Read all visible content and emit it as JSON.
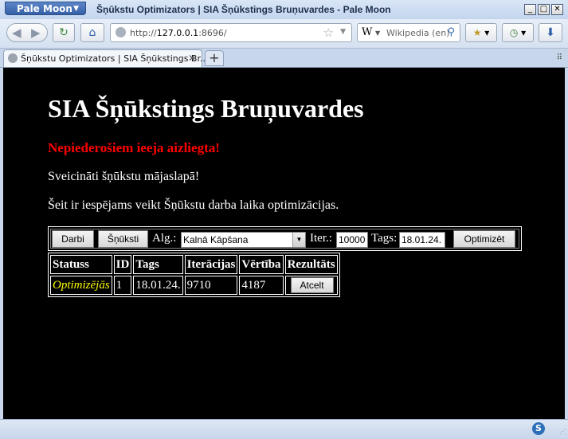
{
  "window": {
    "app_menu": "Pale Moon",
    "title": "Šņūkstu Optimizators | SIA Šņūkstings Bruņuvardes - Pale Moon"
  },
  "toolbar": {
    "url_prefix": "http://",
    "url_host": "127.0.0.1",
    "url_rest": ":8696/",
    "search_placeholder": "Wikipedia (en)",
    "search_engine_icon": "W"
  },
  "tabs": [
    {
      "label": "Šņūkstu Optimizators | SIA Šņūkstings Br..."
    }
  ],
  "page": {
    "heading": "SIA Šņūkstings Bruņuvardes",
    "warning": "Nepiederošiem ieeja aizliegta!",
    "greeting": "Sveicināti šņūkstu mājaslapā!",
    "description": "Šeit ir iespējams veikt Šņūkstu darba laika optimizācijas.",
    "controls": {
      "darbi_button": "Darbi",
      "snuksti_button": "Šņūksti",
      "alg_label": "Alg.:",
      "alg_selected": "Kalnā Kāpšana",
      "iter_label": "Iter.:",
      "iter_value": "10000",
      "tags_label": "Tags:",
      "tags_value": "18.01.24.",
      "optimize_button": "Optimizēt"
    },
    "table": {
      "headers": [
        "Statuss",
        "ID",
        "Tags",
        "Iterācijas",
        "Vērtība",
        "Rezultāts"
      ],
      "rows": [
        {
          "status": "Optimizējās",
          "id": "1",
          "tags": "18.01.24.",
          "iterations": "9710",
          "value": "4187",
          "action": "Atcelt"
        }
      ]
    }
  },
  "colors": {
    "background": "#000000",
    "warning": "#ff0000",
    "status_running": "#ffff00"
  }
}
